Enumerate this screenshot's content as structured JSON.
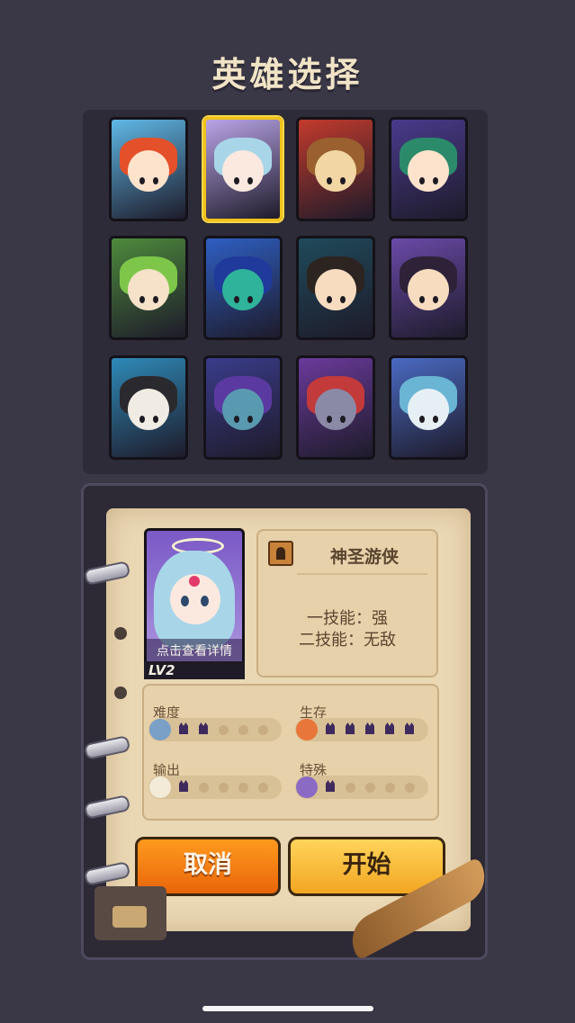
{
  "screen": {
    "title": "英雄选择"
  },
  "heroes": [
    {
      "id": "hero-1",
      "selected": false,
      "bg": "#5fb8e6",
      "skin": "#fde3cc",
      "hair": "#e4502a"
    },
    {
      "id": "hero-2",
      "selected": true,
      "bg": "#b9a4e6",
      "skin": "#fbe9df",
      "hair": "#a8d6e8"
    },
    {
      "id": "hero-3",
      "selected": false,
      "bg": "#c23a2c",
      "skin": "#f2d6a3",
      "hair": "#9a6030"
    },
    {
      "id": "hero-4",
      "selected": false,
      "bg": "#4a3a8c",
      "skin": "#fde3cc",
      "hair": "#2a8a6a"
    },
    {
      "id": "hero-5",
      "selected": false,
      "bg": "#4d8a3c",
      "skin": "#f5e2c8",
      "hair": "#7ec64a"
    },
    {
      "id": "hero-6",
      "selected": false,
      "bg": "#2e5fc2",
      "skin": "#2fb39a",
      "hair": "#1f3a9a"
    },
    {
      "id": "hero-7",
      "selected": false,
      "bg": "#1f4a5a",
      "skin": "#f7dcc0",
      "hair": "#2c2420"
    },
    {
      "id": "hero-8",
      "selected": false,
      "bg": "#6a4aa8",
      "skin": "#f7dcc0",
      "hair": "#2e2238"
    },
    {
      "id": "hero-9",
      "selected": false,
      "bg": "#2e8ab8",
      "skin": "#f0ece4",
      "hair": "#2a2a2e"
    },
    {
      "id": "hero-10",
      "selected": false,
      "bg": "#3a3c8a",
      "skin": "#5a9ab0",
      "hair": "#5a3aa0"
    },
    {
      "id": "hero-11",
      "selected": false,
      "bg": "#6a3a9a",
      "skin": "#8a8aa6",
      "hair": "#c23a3a"
    },
    {
      "id": "hero-12",
      "selected": false,
      "bg": "#4a6ac2",
      "skin": "#e6f0f4",
      "hair": "#6ab4d4"
    }
  ],
  "detail": {
    "view_details": "点击查看详情",
    "level": "LV2",
    "name": "神圣游侠",
    "skill1": "一技能：强",
    "skill2": "二技能：无敌"
  },
  "stats": [
    {
      "label": "难度",
      "icon": "difficulty-icon",
      "filled": 2,
      "total": 5,
      "color": "#7aa0c8"
    },
    {
      "label": "生存",
      "icon": "heart-icon",
      "filled": 5,
      "total": 5,
      "color": "#e8763a"
    },
    {
      "label": "输出",
      "icon": "fist-icon",
      "filled": 1,
      "total": 5,
      "color": "#f3ead8"
    },
    {
      "label": "特殊",
      "icon": "question-icon",
      "filled": 1,
      "total": 5,
      "color": "#8a6ac2"
    }
  ],
  "buttons": {
    "cancel": "取消",
    "start": "开始"
  }
}
